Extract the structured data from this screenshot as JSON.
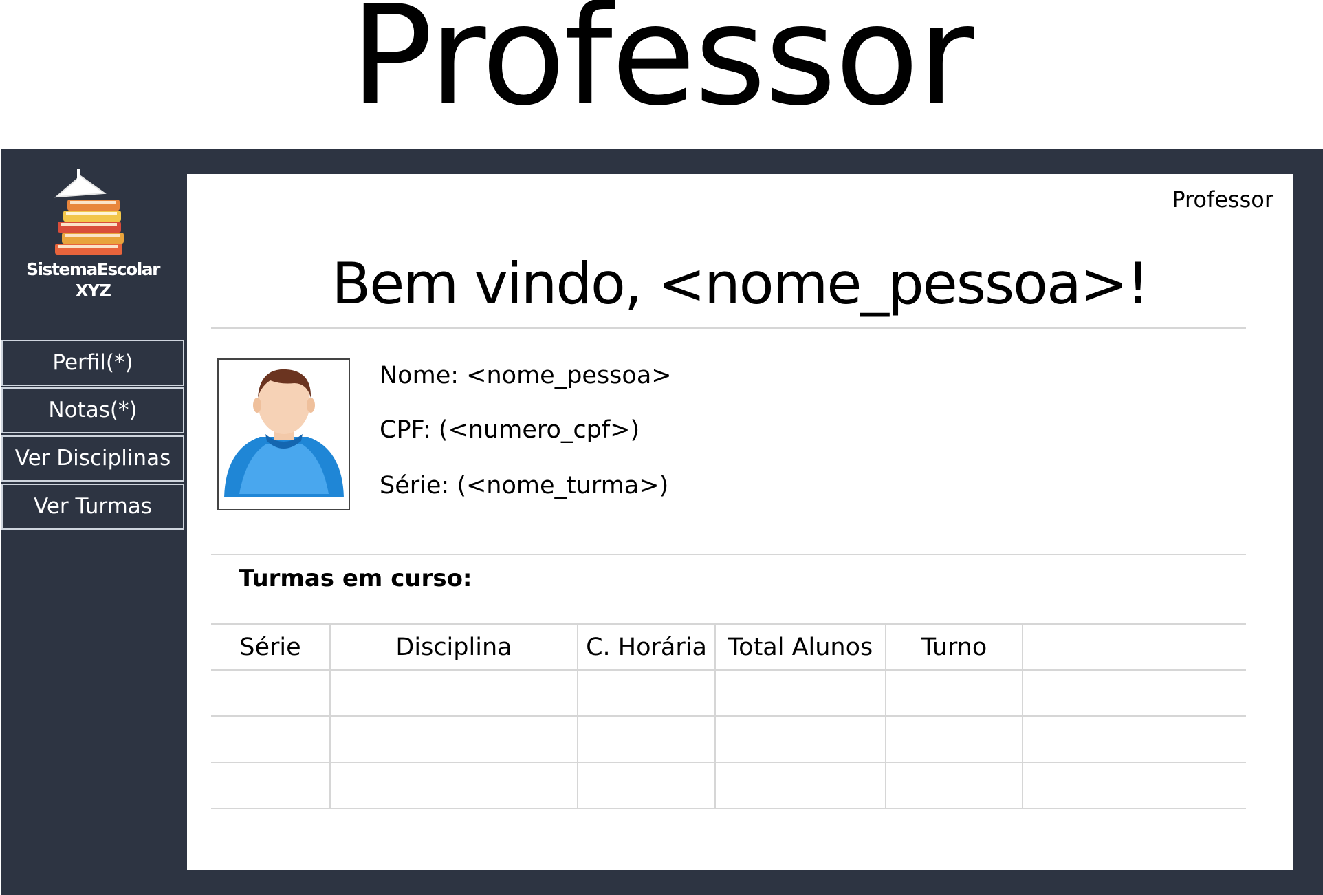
{
  "page_heading": "Professor",
  "brand": {
    "line1": "SistemaEscolar",
    "line2": "XYZ",
    "logo_icon": "books-stack-icon"
  },
  "nav": [
    {
      "label": "Perfil(*)"
    },
    {
      "label": "Notas(*)"
    },
    {
      "label": "Ver Disciplinas"
    },
    {
      "label": "Ver Turmas"
    }
  ],
  "header": {
    "role": "Professor",
    "welcome": "Bem vindo, <nome_pessoa>!"
  },
  "profile": {
    "avatar_icon": "user-avatar-icon",
    "nome": "Nome: <nome_pessoa>",
    "cpf": "CPF: (<numero_cpf>)",
    "serie": "Série: (<nome_turma>)"
  },
  "classes": {
    "title": "Turmas em curso:",
    "columns": [
      "Série",
      "Disciplina",
      "C. Horária",
      "Total Alunos",
      "Turno",
      ""
    ],
    "rows": [
      [
        "",
        "",
        "",
        "",
        "",
        ""
      ],
      [
        "",
        "",
        "",
        "",
        "",
        ""
      ],
      [
        "",
        "",
        "",
        "",
        "",
        ""
      ]
    ]
  },
  "colors": {
    "frame": "#2d3442",
    "nav_border": "#cfd5de",
    "divider": "#d6d6d6"
  }
}
